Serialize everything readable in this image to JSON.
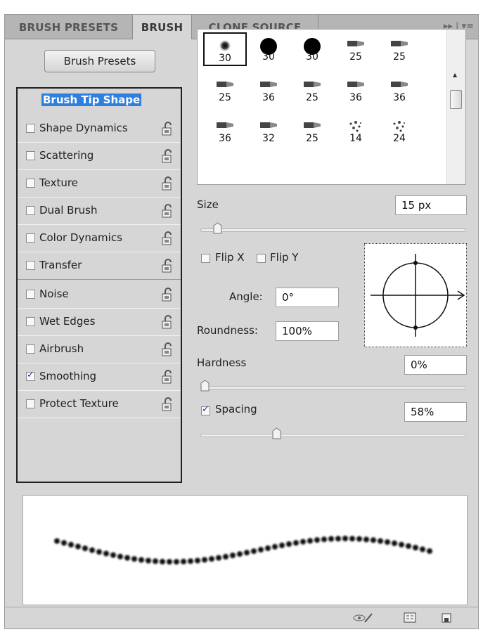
{
  "tabs": [
    {
      "label": "BRUSH PRESETS"
    },
    {
      "label": "BRUSH"
    },
    {
      "label": "CLONE SOURCE"
    }
  ],
  "tab_tools": "▸▸ | ▾≡",
  "brush_presets_button": "Brush Presets",
  "options": [
    {
      "label": "Brush Tip Shape",
      "checked": false,
      "selected": true
    },
    {
      "label": "Shape Dynamics",
      "checked": false
    },
    {
      "label": "Scattering",
      "checked": false
    },
    {
      "label": "Texture",
      "checked": false
    },
    {
      "label": "Dual Brush",
      "checked": false
    },
    {
      "label": "Color Dynamics",
      "checked": false
    },
    {
      "label": "Transfer",
      "checked": false
    },
    {
      "label": "Noise",
      "checked": false
    },
    {
      "label": "Wet Edges",
      "checked": false
    },
    {
      "label": "Airbrush",
      "checked": false
    },
    {
      "label": "Smoothing",
      "checked": true
    },
    {
      "label": "Protect Texture",
      "checked": false
    }
  ],
  "presets": [
    {
      "size": "30",
      "icon": "soft-round-brush-icon"
    },
    {
      "size": "30",
      "icon": "hard-round-brush-icon"
    },
    {
      "size": "30",
      "icon": "hard-round-brush-icon"
    },
    {
      "size": "25",
      "icon": "pencil-tip-brush-icon"
    },
    {
      "size": "25",
      "icon": "flat-tip-brush-icon"
    },
    {
      "size": "25",
      "icon": "flat-blunt-brush-icon"
    },
    {
      "size": "36",
      "icon": "flat-curve-brush-icon"
    },
    {
      "size": "25",
      "icon": "fan-brush-icon"
    },
    {
      "size": "36",
      "icon": "angled-brush-icon"
    },
    {
      "size": "36",
      "icon": "flat-bristle-brush-icon"
    },
    {
      "size": "36",
      "icon": "round-bristle-brush-icon"
    },
    {
      "size": "32",
      "icon": "flat-angle-brush-icon"
    },
    {
      "size": "25",
      "icon": "wide-flat-brush-icon"
    },
    {
      "size": "14",
      "icon": "spatter-brush-icon"
    },
    {
      "size": "24",
      "icon": "spatter-dense-brush-icon"
    }
  ],
  "size": {
    "label": "Size",
    "value": "15 px",
    "level": 0.05
  },
  "flip_x": {
    "label": "Flip X",
    "checked": false
  },
  "flip_y": {
    "label": "Flip Y",
    "checked": false
  },
  "angle": {
    "label": "Angle:",
    "value": "0°"
  },
  "roundness": {
    "label": "Roundness:",
    "value": "100%"
  },
  "hardness": {
    "label": "Hardness",
    "value": "0%",
    "level": 0.0
  },
  "spacing": {
    "label": "Spacing",
    "value": "58%",
    "checked": true,
    "level": 0.28
  },
  "colors": {
    "selection": "#2d7fe0",
    "panel": "#d6d6d6"
  }
}
